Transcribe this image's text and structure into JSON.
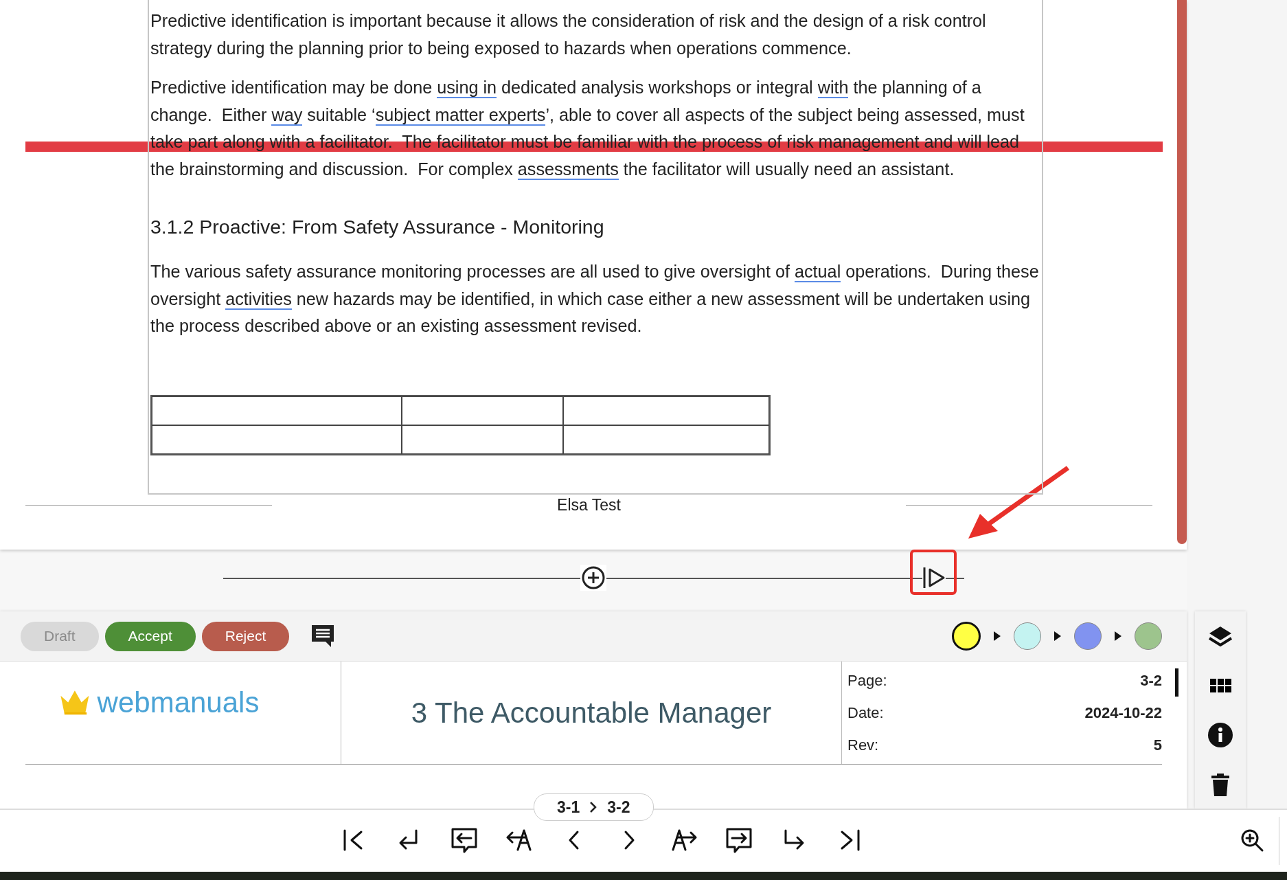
{
  "document": {
    "blocks": [
      {
        "kind": "paragraph",
        "runs": [
          {
            "text": "Predictive identification is important because it allows the consideration of risk and the design of a risk control strategy during the planning prior to being exposed to hazards when operations commence.",
            "underlined": false
          }
        ]
      },
      {
        "kind": "paragraph",
        "runs": [
          {
            "text": "Predictive identification may be done ",
            "underlined": false
          },
          {
            "text": "using in",
            "underlined": true
          },
          {
            "text": " dedicated analysis workshops or integral ",
            "underlined": false
          },
          {
            "text": "with",
            "underlined": true
          },
          {
            "text": " the planning of a change.  Either ",
            "underlined": false
          },
          {
            "text": "way",
            "underlined": true
          },
          {
            "text": " suitable ‘",
            "underlined": false
          },
          {
            "text": "subject matter experts",
            "underlined": true
          },
          {
            "text": "’, able to cover all aspects of the subject being assessed, must take part along with a facilitator.  The facilitator must be familiar with the process of risk management and will lead the brainstorming and discussion.  For complex ",
            "underlined": false
          },
          {
            "text": "assessments",
            "underlined": true
          },
          {
            "text": " the facilitator will usually need an assistant.",
            "underlined": false
          }
        ]
      },
      {
        "kind": "heading",
        "runs": [
          {
            "text": "3.1.2 Proactive: From Safety Assurance - Monitoring",
            "underlined": false
          }
        ]
      },
      {
        "kind": "paragraph",
        "runs": [
          {
            "text": "The various safety assurance monitoring processes are all used to give oversight of ",
            "underlined": false
          },
          {
            "text": "actual",
            "underlined": true
          },
          {
            "text": " operations.  During these oversight ",
            "underlined": false
          },
          {
            "text": "activities",
            "underlined": true
          },
          {
            "text": " new hazards may be identified, in which case either a new assessment will be undertaken using the process described above or an existing assessment revised.",
            "underlined": false
          }
        ]
      }
    ],
    "footer": "Elsa Test"
  },
  "toolbar": {
    "buttons": [
      {
        "label": "Draft",
        "kind": "draft",
        "disabled": true
      },
      {
        "label": "Accept",
        "kind": "accept",
        "disabled": false
      },
      {
        "label": "Reject",
        "kind": "reject",
        "disabled": false
      }
    ],
    "colors": [
      {
        "color": "#ffff44",
        "selected": true
      },
      {
        "color": "#c4f3f1",
        "selected": false
      },
      {
        "color": "#8193f0",
        "selected": false
      },
      {
        "color": "#9dc48d",
        "selected": false
      }
    ]
  },
  "header": {
    "logo": "webmanuals",
    "title": "3 The Accountable Manager",
    "info": [
      {
        "label": "Page:",
        "value": "3-2",
        "current": true
      },
      {
        "label": "Date:",
        "value": "2024-10-22",
        "current": false
      },
      {
        "label": "Rev:",
        "value": "5",
        "current": false
      }
    ]
  },
  "breadcrumb": {
    "from": "3-1",
    "to": "3-2"
  }
}
